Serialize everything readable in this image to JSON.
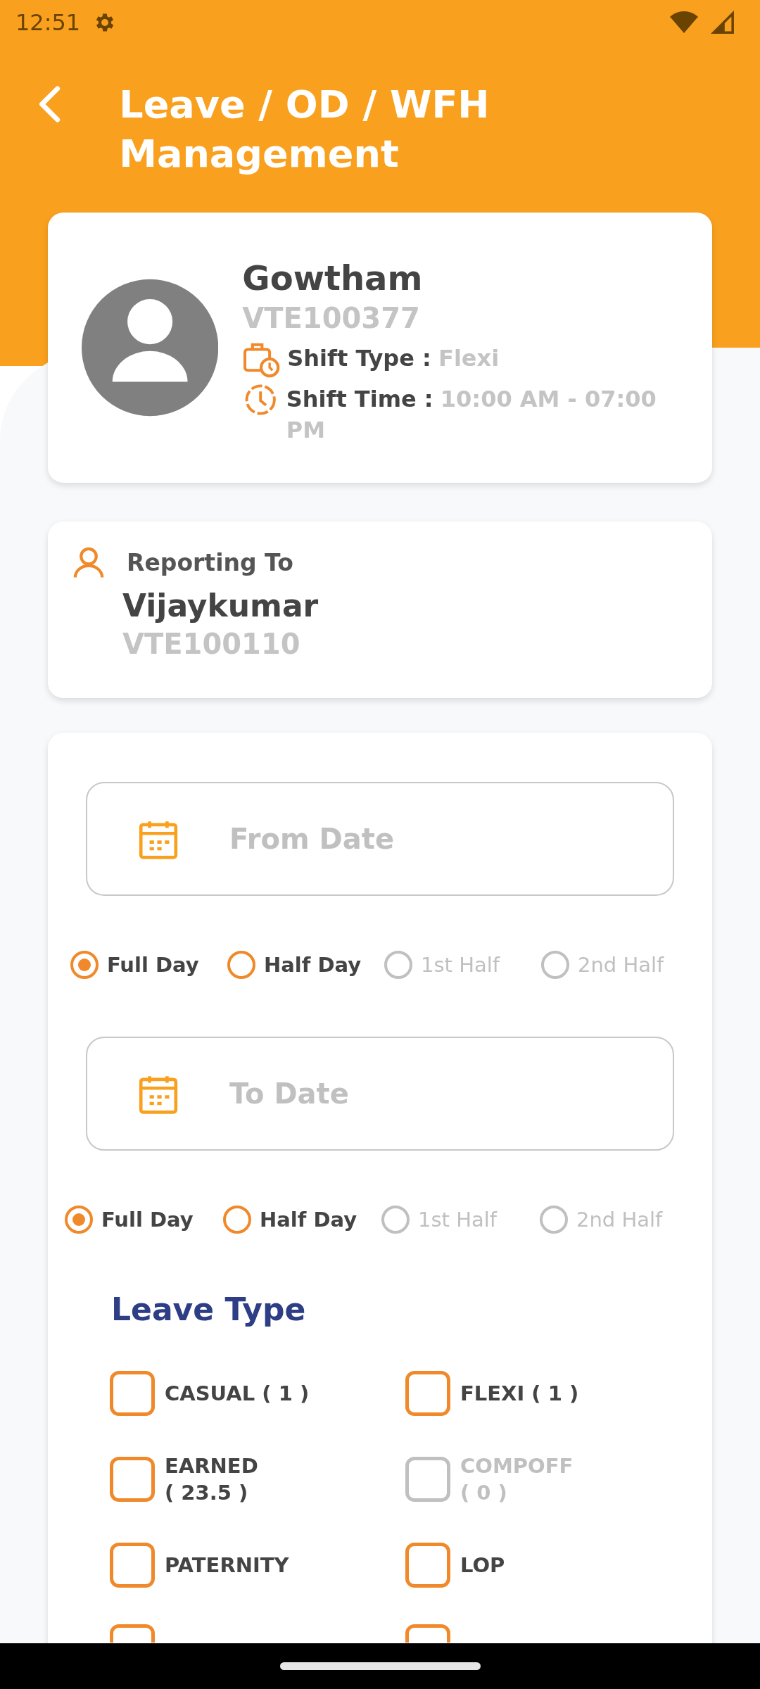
{
  "status_bar": {
    "time": "12:51"
  },
  "header": {
    "title": "Leave / OD / WFH Management"
  },
  "profile": {
    "name": "Gowtham",
    "employee_id": "VTE100377",
    "shift_type_label": "Shift Type :",
    "shift_type": "Flexi",
    "shift_time_label": "Shift Time :",
    "shift_time": "10:00 AM - 07:00 PM"
  },
  "reporting": {
    "label": "Reporting To",
    "name": "Vijaykumar",
    "employee_id": "VTE100110"
  },
  "from_date": {
    "placeholder": "From Date",
    "options": [
      {
        "label": "Full Day",
        "selected": true,
        "disabled": false
      },
      {
        "label": "Half Day",
        "selected": false,
        "disabled": false
      },
      {
        "label": "1st Half",
        "selected": false,
        "disabled": true
      },
      {
        "label": "2nd Half",
        "selected": false,
        "disabled": true
      }
    ]
  },
  "to_date": {
    "placeholder": "To Date",
    "options": [
      {
        "label": "Full Day",
        "selected": true,
        "disabled": false
      },
      {
        "label": "Half Day",
        "selected": false,
        "disabled": false
      },
      {
        "label": "1st Half",
        "selected": false,
        "disabled": true
      },
      {
        "label": "2nd Half",
        "selected": false,
        "disabled": true
      }
    ]
  },
  "leave_type": {
    "title": "Leave Type",
    "options": [
      {
        "label": "CASUAL ( 1 )",
        "checked": false,
        "disabled": false
      },
      {
        "label": "FLEXI ( 1 )",
        "checked": false,
        "disabled": false
      },
      {
        "label": "EARNED\n( 23.5 )",
        "checked": false,
        "disabled": false
      },
      {
        "label": "COMPOFF\n( 0 )",
        "checked": false,
        "disabled": true
      },
      {
        "label": "PATERNITY",
        "checked": false,
        "disabled": false
      },
      {
        "label": "LOP",
        "checked": false,
        "disabled": false
      },
      {
        "checked": false,
        "disabled": false
      },
      {
        "checked": false,
        "disabled": false
      }
    ]
  }
}
